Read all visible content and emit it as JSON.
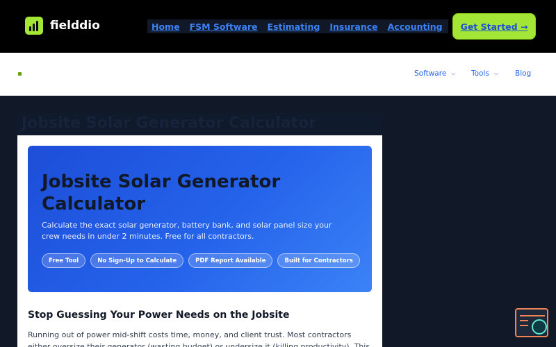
{
  "header": {
    "brand": "fielddio",
    "nav": [
      "Home",
      "FSM Software",
      "Estimating",
      "Insurance",
      "Accounting"
    ],
    "cta_label": "Get Started →"
  },
  "subnav": {
    "items": [
      {
        "label": "Software",
        "has_dropdown": true
      },
      {
        "label": "Tools",
        "has_dropdown": true
      },
      {
        "label": "Blog",
        "has_dropdown": false
      }
    ]
  },
  "hero": {
    "title": "Jobsite Solar Generator Calculator",
    "description": "Calculate the exact solar generator, battery bank, and solar panel size your crew needs in under 2 minutes. Free for all contractors.",
    "badges": [
      "Free Tool",
      "No Sign-Up to Calculate",
      "PDF Report Available",
      "Built for Contractors"
    ]
  },
  "content": {
    "heading": "Stop Guessing Your Power Needs on the Jobsite",
    "paragraph": "Running out of power mid-shift costs time, money, and client trust. Most contractors either oversize their generator (wasting budget) or undersize it (killing productivity). This calculator"
  },
  "colors": {
    "accent": "#a3e635",
    "link": "#3b82f6",
    "hero": "#2563eb",
    "background": "#111827"
  },
  "icons": {
    "logo": "bar-chart-icon",
    "dropdown": "chevron-down-icon",
    "widget": "terminal-search-icon"
  }
}
